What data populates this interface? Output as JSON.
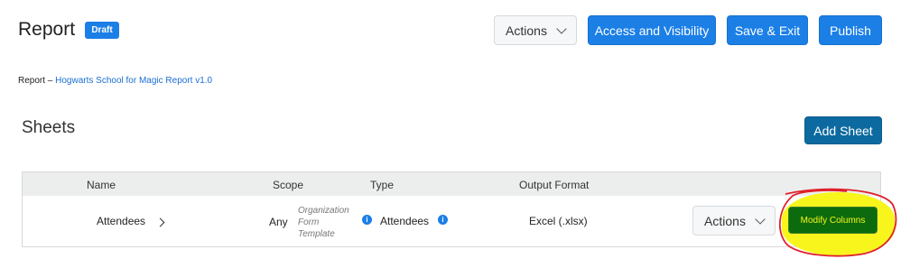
{
  "header": {
    "title": "Report",
    "status_badge": "Draft",
    "actions_label": "Actions",
    "access_visibility_label": "Access and Visibility",
    "save_exit_label": "Save & Exit",
    "publish_label": "Publish"
  },
  "breadcrumb": {
    "root": "Report",
    "separator": "–",
    "current": "Hogwarts School for Magic Report v1.0"
  },
  "sheets": {
    "title": "Sheets",
    "add_sheet_label": "Add Sheet",
    "columns": [
      "Name",
      "Scope",
      "Type",
      "Output Format"
    ],
    "rows": [
      {
        "name": "Attendees",
        "scope": "Any",
        "scope_note_lines": [
          "Organization",
          "Form",
          "Template"
        ],
        "type": "Attendees",
        "output_format": "Excel (.xlsx)",
        "actions_label": "Actions",
        "modify_columns_label": "Modify Columns"
      }
    ]
  },
  "colors": {
    "primary_blue": "#1b7fe6",
    "teal": "#0d6aa0",
    "highlight_yellow": "#f7f51c",
    "annotation_red": "#e0202a",
    "modify_green": "#0c6b0c"
  }
}
